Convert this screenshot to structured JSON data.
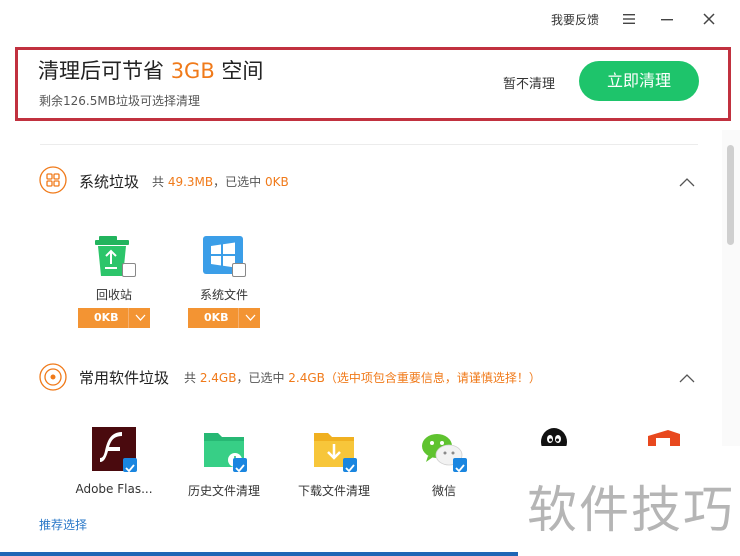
{
  "topbar": {
    "feedback": "我要反馈"
  },
  "summary": {
    "title_prefix": "清理后可节省 ",
    "title_amount": "3GB",
    "title_suffix": " 空间",
    "subtitle": "剩余126.5MB垃圾可选择清理",
    "skip_label": "暂不清理",
    "clean_label": "立即清理"
  },
  "sections": [
    {
      "title": "系统垃圾",
      "meta_total_prefix": "共 ",
      "meta_total": "49.3MB",
      "meta_selected_prefix": "，已选中 ",
      "meta_selected": "0KB",
      "items": [
        {
          "label": "回收站",
          "size": "0KB",
          "checked": false,
          "icon": "recycle-bin-icon"
        },
        {
          "label": "系统文件",
          "size": "0KB",
          "checked": false,
          "icon": "windows-icon"
        }
      ]
    },
    {
      "title": "常用软件垃圾",
      "meta_total_prefix": "共 ",
      "meta_total": "2.4GB",
      "meta_selected_prefix": "，已选中 ",
      "meta_selected": "2.4GB",
      "meta_warning": "（选中项包含重要信息，请谨慎选择！）",
      "items": [
        {
          "label": "Adobe Flas...",
          "checked": true,
          "icon": "flash-icon"
        },
        {
          "label": "历史文件清理",
          "checked": true,
          "icon": "history-folder-icon"
        },
        {
          "label": "下载文件清理",
          "checked": true,
          "icon": "download-folder-icon"
        },
        {
          "label": "微信",
          "checked": true,
          "icon": "wechat-icon"
        },
        {
          "label": "",
          "icon": "qq-icon"
        },
        {
          "label": "",
          "icon": "office-icon"
        }
      ]
    }
  ],
  "recommend_label": "推荐选择",
  "watermark": "软件技巧",
  "colors": {
    "accent": "#f07a1a",
    "green": "#1ec46b",
    "highlight_border": "#c1313f",
    "checkbox": "#1a86e0",
    "size_button": "#f39433"
  }
}
